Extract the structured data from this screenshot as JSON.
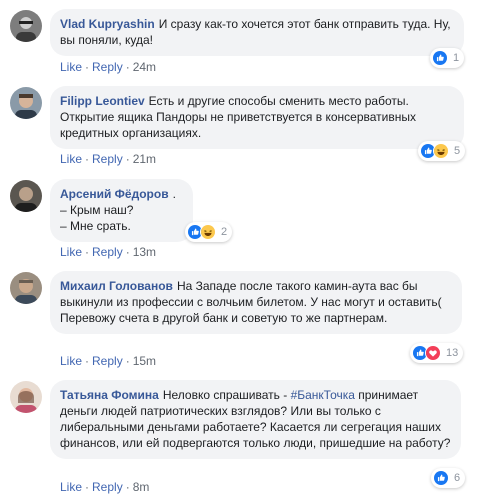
{
  "actions": {
    "like": "Like",
    "reply": "Reply",
    "separator": "·"
  },
  "colors": {
    "link": "#4267b2",
    "bubble": "#f2f3f5",
    "like_blue": "#1877f2",
    "love_red": "#f33e58",
    "haha_yellow": "#fcc84d"
  },
  "comments": [
    {
      "author": "Vlad Kupryashin",
      "text": "И сразу как-то хочется этот банк отправить туда. Ну, вы поняли, куда!",
      "time": "24m",
      "reactions": [
        "like-icon"
      ],
      "reaction_count": "1"
    },
    {
      "author": "Filipp Leontiev",
      "text": "Есть и другие способы сменить место работы. Открытие ящика Пандоры не приветствуется в консервативных кредитных организациях.",
      "time": "21m",
      "reactions": [
        "like-icon",
        "haha-icon"
      ],
      "reaction_count": "5"
    },
    {
      "author": "Арсений Фёдоров",
      "text_lines": [
        ".",
        "– Крым наш?",
        "– Мне срать."
      ],
      "time": "13m",
      "reactions": [
        "like-icon",
        "haha-icon"
      ],
      "reaction_count": "2"
    },
    {
      "author": "Михаил Голованов",
      "text": "На Западе после такого камин-аута вас бы выкинули из профессии с волчьим билетом. У нас могут и оставить( Перевожу счета в другой банк и советую то же партнерам.",
      "time": "15m",
      "reactions": [
        "like-icon",
        "love-icon"
      ],
      "reaction_count": "13"
    },
    {
      "author": "Татьяна Фомина",
      "text_before": "Неловко спрашивать - ",
      "hashtag": "#БанкТочка",
      "text_after": " принимает деньги людей патриотических взглядов? Или вы только с либеральными деньгами работаете? Касается ли сегрегация наших финансов, или ей подвергаются только люди, пришедшие на работу?",
      "time": "8m",
      "reactions": [
        "like-icon"
      ],
      "reaction_count": "6"
    }
  ]
}
